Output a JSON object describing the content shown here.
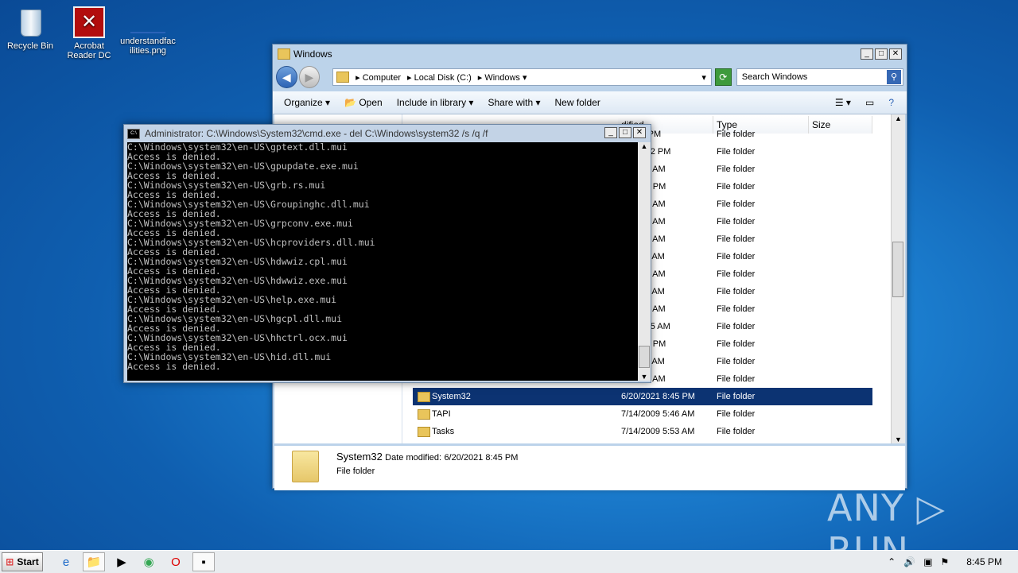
{
  "desktop": {
    "icons": [
      {
        "label": "Recycle Bin"
      },
      {
        "label": "Acrobat\nReader DC"
      },
      {
        "label": "understandfac\nilities.png"
      }
    ]
  },
  "explorer": {
    "title": "Windows",
    "breadcrumb": [
      "Computer",
      "Local Disk (C:)",
      "Windows"
    ],
    "search_placeholder": "Search Windows",
    "toolbar": {
      "organize": "Organize",
      "open": "Open",
      "include": "Include in library",
      "share": "Share with",
      "new_folder": "New folder"
    },
    "columns": {
      "date": "dified",
      "type": "Type",
      "size": "Size"
    },
    "rows": [
      {
        "name": "",
        "date": "8 1:20 PM",
        "type": "File folder"
      },
      {
        "name": "",
        "date": "18 12:22 PM",
        "type": "File folder"
      },
      {
        "name": "",
        "date": "09 3:37 AM",
        "type": "File folder"
      },
      {
        "name": "",
        "date": "17 6:19 PM",
        "type": "File folder"
      },
      {
        "name": "",
        "date": "09 5:52 AM",
        "type": "File folder"
      },
      {
        "name": "",
        "date": "09 3:05 AM",
        "type": "File folder"
      },
      {
        "name": "",
        "date": "09 5:52 AM",
        "type": "File folder"
      },
      {
        "name": "",
        "date": "11 3:24 AM",
        "type": "File folder"
      },
      {
        "name": "",
        "date": "09 5:34 AM",
        "type": "File folder"
      },
      {
        "name": "",
        "date": "11 3:16 AM",
        "type": "File folder"
      },
      {
        "name": "",
        "date": "09 5:34 AM",
        "type": "File folder"
      },
      {
        "name": "",
        "date": "19 10:45 AM",
        "type": "File folder"
      },
      {
        "name": "",
        "date": "18 2:17 PM",
        "type": "File folder"
      },
      {
        "name": "",
        "date": "11 3:16 AM",
        "type": "File folder"
      },
      {
        "name": "",
        "date": "09 5:52 AM",
        "type": "File folder"
      },
      {
        "name": "System32",
        "date": "6/20/2021 8:45 PM",
        "type": "File folder",
        "selected": true
      },
      {
        "name": "TAPI",
        "date": "7/14/2009 5:46 AM",
        "type": "File folder"
      },
      {
        "name": "Tasks",
        "date": "7/14/2009 5:53 AM",
        "type": "File folder"
      }
    ],
    "details": {
      "name": "System32",
      "date_label": "Date modified:",
      "date_value": "6/20/2021 8:45 PM",
      "type": "File folder"
    }
  },
  "cmd": {
    "title": "Administrator: C:\\Windows\\System32\\cmd.exe - del  C:\\Windows\\system32 /s /q /f",
    "lines": [
      "C:\\Windows\\system32\\en-US\\gptext.dll.mui",
      "Access is denied.",
      "C:\\Windows\\system32\\en-US\\gpupdate.exe.mui",
      "Access is denied.",
      "C:\\Windows\\system32\\en-US\\grb.rs.mui",
      "Access is denied.",
      "C:\\Windows\\system32\\en-US\\Groupinghc.dll.mui",
      "Access is denied.",
      "C:\\Windows\\system32\\en-US\\grpconv.exe.mui",
      "Access is denied.",
      "C:\\Windows\\system32\\en-US\\hcproviders.dll.mui",
      "Access is denied.",
      "C:\\Windows\\system32\\en-US\\hdwwiz.cpl.mui",
      "Access is denied.",
      "C:\\Windows\\system32\\en-US\\hdwwiz.exe.mui",
      "Access is denied.",
      "C:\\Windows\\system32\\en-US\\help.exe.mui",
      "Access is denied.",
      "C:\\Windows\\system32\\en-US\\hgcpl.dll.mui",
      "Access is denied.",
      "C:\\Windows\\system32\\en-US\\hhctrl.ocx.mui",
      "Access is denied.",
      "C:\\Windows\\system32\\en-US\\hid.dll.mui",
      "Access is denied."
    ]
  },
  "taskbar": {
    "start": "Start",
    "clock": "8:45 PM"
  },
  "watermark": "ANY ▷ RUN"
}
